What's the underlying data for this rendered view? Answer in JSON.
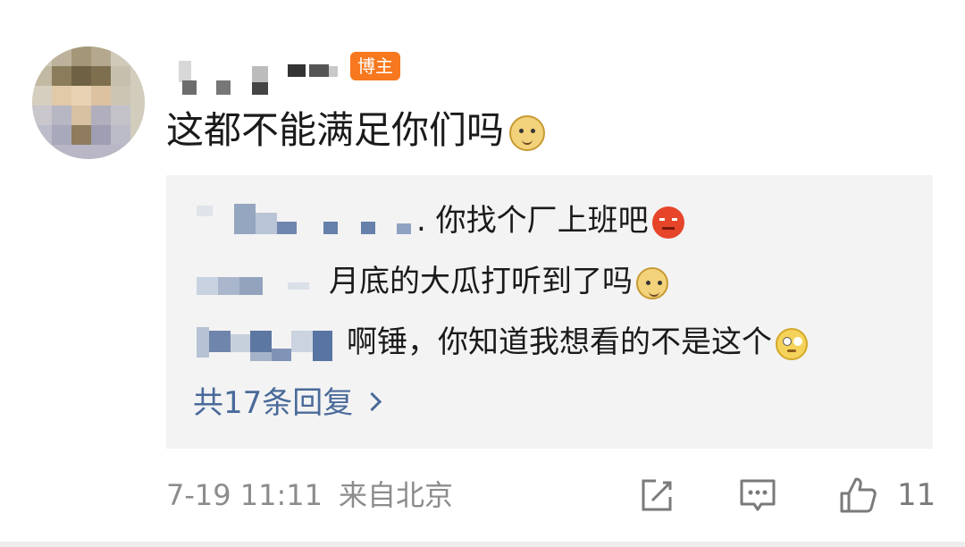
{
  "comment": {
    "badge": "博主",
    "text": "这都不能满足你们吗",
    "emoji": "doge-emoji"
  },
  "replies": [
    {
      "text": ". 你找个厂上班吧",
      "emoji": "angry-emoji"
    },
    {
      "text": "月底的大瓜打听到了吗",
      "emoji": "doge-emoji"
    },
    {
      "text": "啊锤，你知道我想看的不是这个",
      "emoji": "eye-roll-emoji"
    }
  ],
  "more_replies": "共17条回复",
  "footer": {
    "time": "7-19 11:11",
    "source": "来自北京",
    "like_count": "11"
  },
  "colors": {
    "badge": "#f7781e",
    "link": "#4a6a9a",
    "reply_bg": "#f3f3f3",
    "meta": "#8c8c8c"
  }
}
